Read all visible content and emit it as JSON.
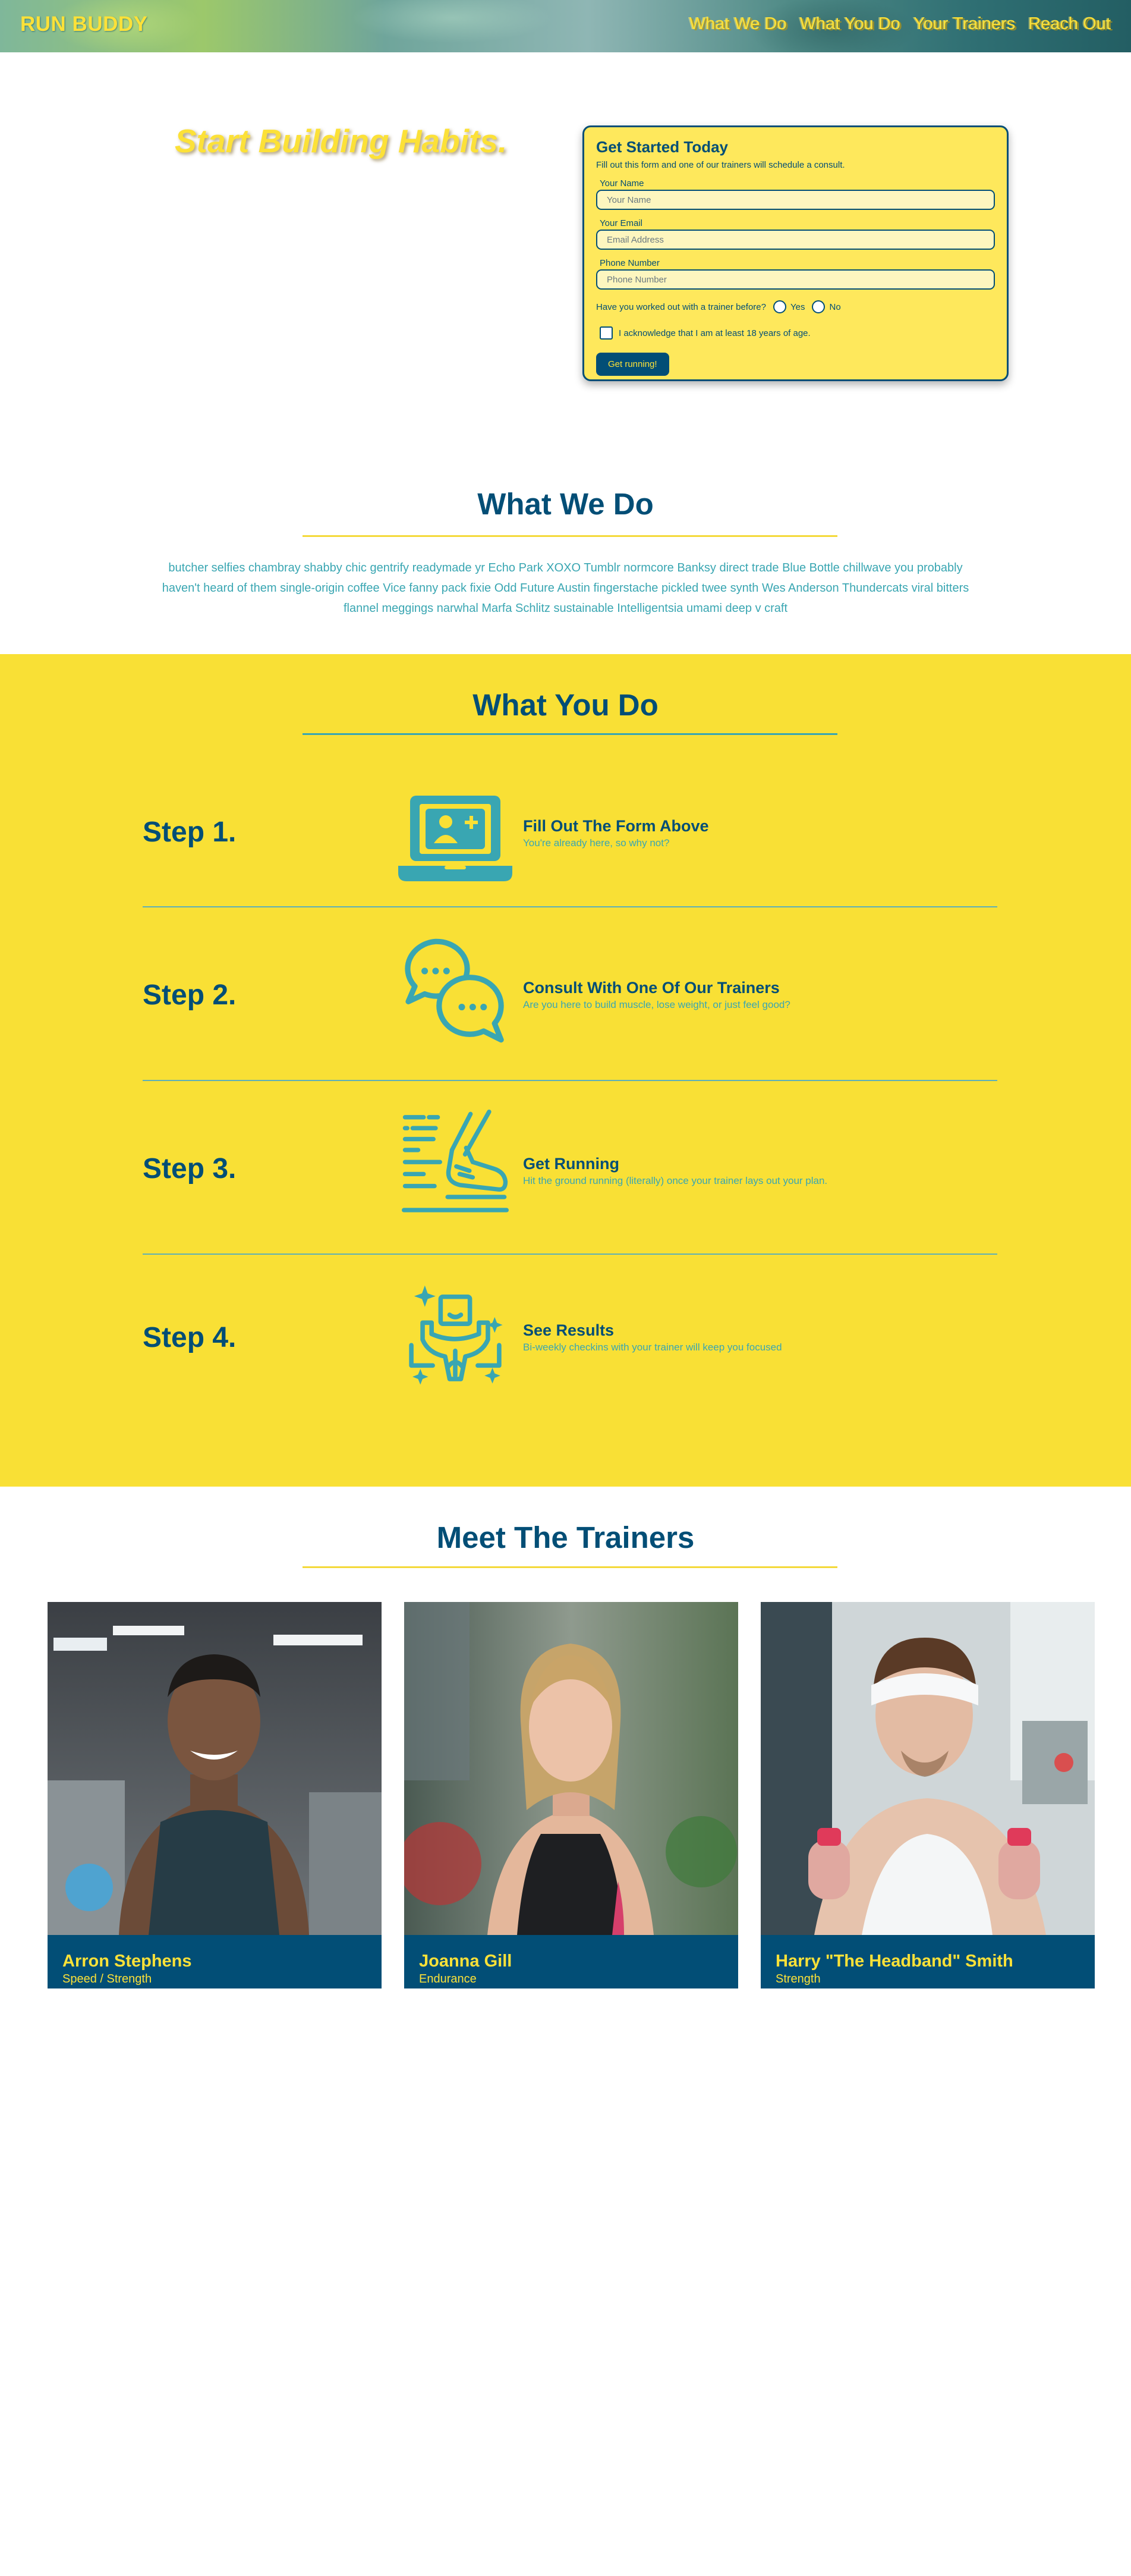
{
  "header": {
    "brand": "RUN BUDDY",
    "nav": [
      "What We Do",
      "What You Do",
      "Your Trainers",
      "Reach Out"
    ]
  },
  "hero": {
    "title": "Start Building Habits."
  },
  "form": {
    "title": "Get Started Today",
    "subtitle": "Fill out this form and one of our trainers will schedule a consult.",
    "name_label": "Your Name",
    "name_placeholder": "Your Name",
    "email_label": "Your Email",
    "email_placeholder": "Email Address",
    "phone_label": "Phone Number",
    "phone_placeholder": "Phone Number",
    "question": "Have you worked out with a trainer before?",
    "yes": "Yes",
    "no": "No",
    "acknowledge": "I acknowledge that I am at least 18 years of age.",
    "submit": "Get running!"
  },
  "what_we_do": {
    "title": "What We Do",
    "text": "butcher selfies chambray shabby chic gentrify readymade yr Echo Park XOXO Tumblr normcore Banksy direct trade Blue Bottle chillwave you probably haven't heard of them single-origin coffee Vice fanny pack fixie Odd Future Austin fingerstache pickled twee synth Wes Anderson Thundercats viral bitters flannel meggings narwhal Marfa Schlitz sustainable Intelligentsia umami deep v craft"
  },
  "what_you_do": {
    "title": "What You Do",
    "steps": [
      {
        "label": "Step 1.",
        "icon": "laptop-add-user-icon",
        "title": "Fill Out The Form Above",
        "text": "You're already here, so why not?"
      },
      {
        "label": "Step 2.",
        "icon": "chat-bubbles-icon",
        "title": "Consult With One Of Our Trainers",
        "text": "Are you here to build muscle, lose weight, or just feel good?"
      },
      {
        "label": "Step 3.",
        "icon": "running-shoe-icon",
        "title": "Get Running",
        "text": "Hit the ground running (literally) once your trainer lays out your plan."
      },
      {
        "label": "Step 4.",
        "icon": "strong-body-icon",
        "title": "See Results",
        "text": "Bi-weekly checkins with your trainer will keep you focused"
      }
    ]
  },
  "trainers": {
    "title": "Meet The Trainers",
    "list": [
      {
        "name": "Arron Stephens",
        "specialty": "Speed / Strength"
      },
      {
        "name": "Joanna Gill",
        "specialty": "Endurance"
      },
      {
        "name": "Harry \"The Headband\" Smith",
        "specialty": "Strength"
      }
    ]
  },
  "colors": {
    "navy": "#024e76",
    "yellow": "#fce138",
    "band_yellow": "#f9e035",
    "teal": "#39a6b2"
  }
}
